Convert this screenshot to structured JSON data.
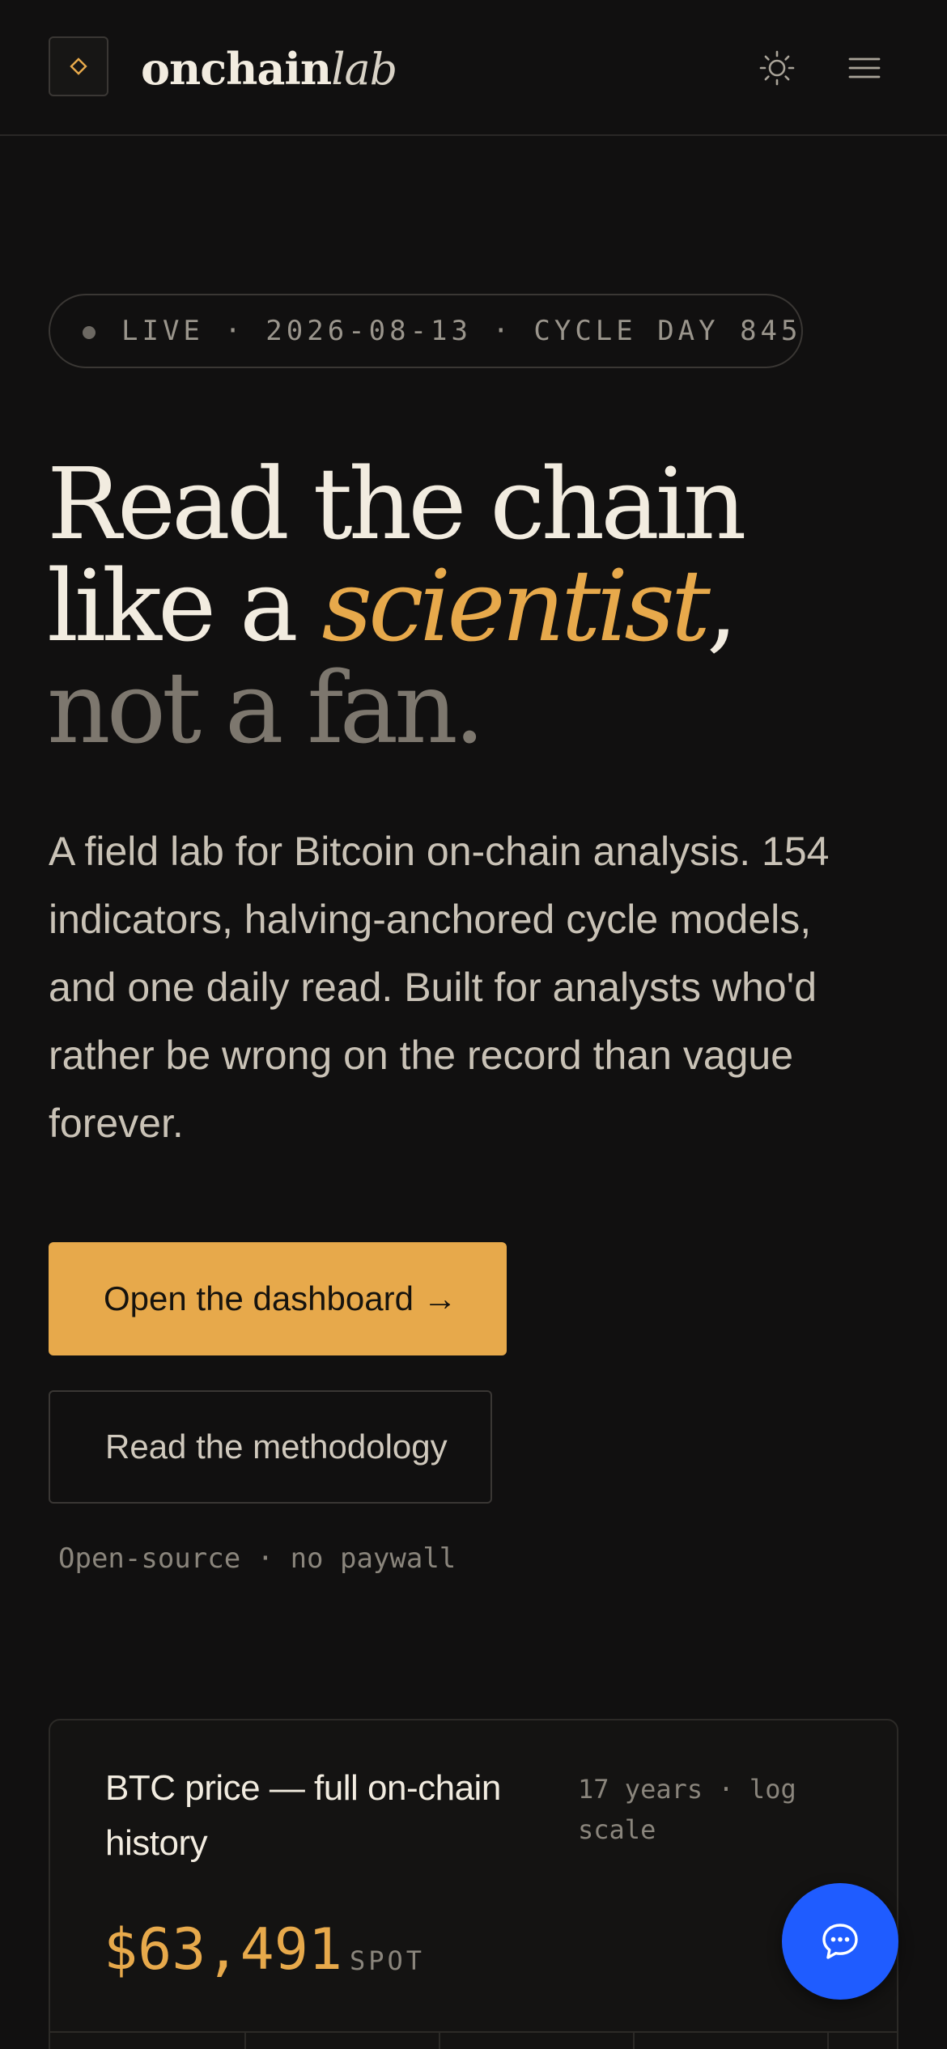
{
  "header": {
    "brand_main": "onchain",
    "brand_italic": "lab",
    "icons": {
      "logo": "diamond-icon",
      "theme": "sun-icon",
      "menu": "hamburger-menu-icon"
    }
  },
  "hero": {
    "live_status": "LIVE · 2026-08-13 · CYCLE DAY 845",
    "headline": {
      "line1": "Read the chain",
      "line2_prefix": "like a ",
      "line2_accent": "scientist",
      "line2_suffix": ",",
      "line3": "not a fan."
    },
    "lede": "A field lab for Bitcoin on-chain analysis. 154 indicators, halving-anchored cycle models, and one daily read. Built for analysts who'd rather be wrong on the record than vague forever.",
    "primary_cta": "Open the dashboard →",
    "secondary_cta": "Read the methodology",
    "note": "Open-source · no paywall"
  },
  "card": {
    "title": "BTC price — full on-chain history",
    "meta": "17 years · log scale",
    "price": "$63,491",
    "price_label": "SPOT"
  },
  "chat": {
    "icon": "chat-bubble-icon"
  },
  "colors": {
    "background": "#111010",
    "accent": "#e7a94b",
    "chat_button": "#1f5cff",
    "text": "#f2ece0",
    "muted": "#7d776e"
  }
}
